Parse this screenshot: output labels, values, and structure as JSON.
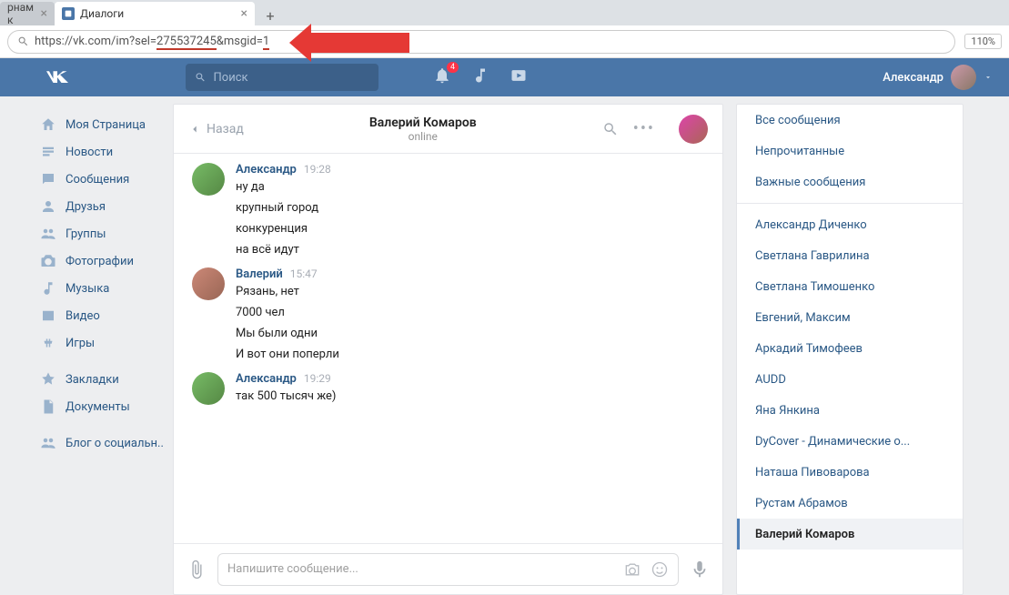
{
  "browser": {
    "tab_inactive": "рнам к",
    "tab_active": "Диалоги",
    "url_prefix": "https://vk.com/im?sel=",
    "url_sel": "275537245",
    "url_amp": "&msgid=",
    "url_msgid": "1",
    "zoom": "110%"
  },
  "header": {
    "search_placeholder": "Поиск",
    "notif_count": "4",
    "username": "Александр"
  },
  "nav": {
    "items": [
      "Моя Страница",
      "Новости",
      "Сообщения",
      "Друзья",
      "Группы",
      "Фотографии",
      "Музыка",
      "Видео",
      "Игры"
    ],
    "items2": [
      "Закладки",
      "Документы"
    ],
    "items3": [
      "Блог о социальн.."
    ]
  },
  "chat": {
    "back": "Назад",
    "title": "Валерий Комаров",
    "status": "online",
    "input_placeholder": "Напишите сообщение...",
    "groups": [
      {
        "name": "Александр",
        "time": "19:28",
        "avatar": "a",
        "lines": [
          "ну да",
          "крупный город",
          "конкуренция",
          "на всё идут"
        ]
      },
      {
        "name": "Валерий",
        "time": "15:47",
        "avatar": "b",
        "lines": [
          "Рязань, нет",
          "7000 чел",
          "Мы были одни",
          "И вот они поперли"
        ]
      },
      {
        "name": "Александр",
        "time": "19:29",
        "avatar": "a",
        "lines": [
          "так 500 тысяч же)"
        ]
      }
    ]
  },
  "filters": {
    "top": [
      "Все сообщения",
      "Непрочитанные",
      "Важные сообщения"
    ],
    "contacts": [
      "Александр Диченко",
      "Светлана Гаврилина",
      "Светлана Тимошенко",
      "Евгений, Максим",
      "Аркадий Тимофеев",
      "AUDD",
      "Яна Янкина",
      "DyCover - Динамические о...",
      "Наташа Пивоварова",
      "Рустам Абрамов",
      "Валерий Комаров"
    ],
    "active": "Валерий Комаров"
  }
}
